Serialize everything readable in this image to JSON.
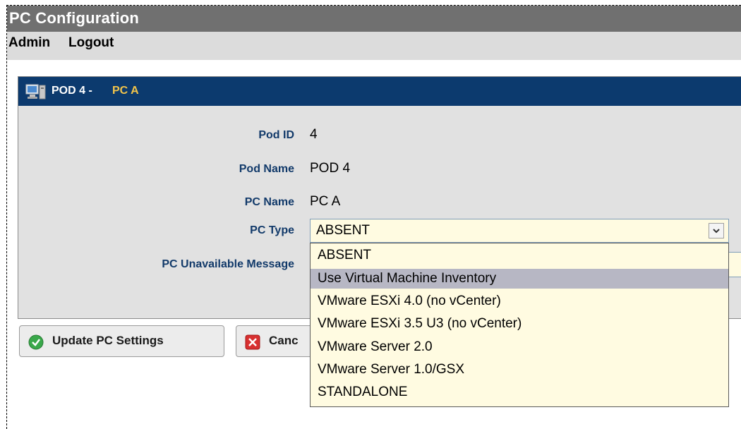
{
  "window": {
    "title": "PC Configuration"
  },
  "menu": {
    "admin": "Admin",
    "logout": "Logout"
  },
  "panel": {
    "pod_label": "POD 4 - ",
    "pc_label": "PC A",
    "fields": {
      "pod_id_label": "Pod ID",
      "pod_id_value": "4",
      "pod_name_label": "Pod Name",
      "pod_name_value": "POD 4",
      "pc_name_label": "PC Name",
      "pc_name_value": "PC A",
      "pc_type_label": "PC Type",
      "pc_type_value": "ABSENT",
      "pc_unavailable_label": "PC Unavailable Message"
    },
    "pc_type_options": [
      "ABSENT",
      "Use Virtual Machine Inventory",
      "VMware ESXi 4.0 (no vCenter)",
      "VMware ESXi 3.5 U3 (no vCenter)",
      "VMware Server 2.0",
      "VMware Server 1.0/GSX",
      "STANDALONE"
    ],
    "highlighted_option_index": 1
  },
  "buttons": {
    "update": "Update PC Settings",
    "cancel": "Canc"
  },
  "colors": {
    "title_bar": "#707070",
    "panel_header": "#0c3a6e",
    "pc_accent": "#f2c44a",
    "label_text": "#123a6a",
    "input_bg": "#fffbe1",
    "highlight": "#b7b7c4"
  },
  "icons": {
    "panel": "computer-icon",
    "update": "green-check-icon",
    "cancel": "red-x-icon",
    "dropdown": "chevron-down-icon"
  }
}
